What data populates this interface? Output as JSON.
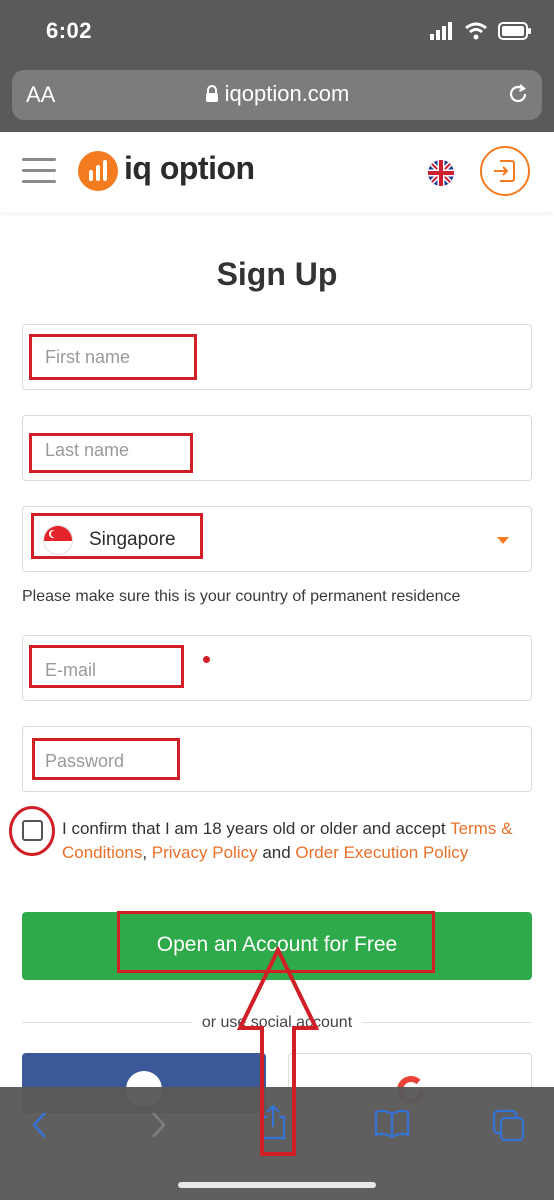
{
  "status": {
    "time": "6:02"
  },
  "browser": {
    "text_size_label": "AA",
    "url": "iqoption.com"
  },
  "header": {
    "logo_text": "iq option"
  },
  "form": {
    "title": "Sign Up",
    "first_name_placeholder": "First name",
    "last_name_placeholder": "Last name",
    "country": "Singapore",
    "country_hint": "Please make sure this is your country of permanent residence",
    "email_placeholder": "E-mail",
    "password_placeholder": "Password",
    "consent": {
      "text_before": "I confirm that I am 18 years old or older and accept ",
      "terms": "Terms & Conditions",
      "comma": ", ",
      "privacy": "Privacy Policy",
      "and": " and ",
      "execution": "Order Execution Policy"
    },
    "submit": "Open an Account for Free",
    "social_divider": "or use social account"
  },
  "colors": {
    "brand_orange": "#f47b20",
    "cta_green": "#2eaa4a",
    "facebook_blue": "#3b5998",
    "annotation_red": "#d11f28"
  }
}
